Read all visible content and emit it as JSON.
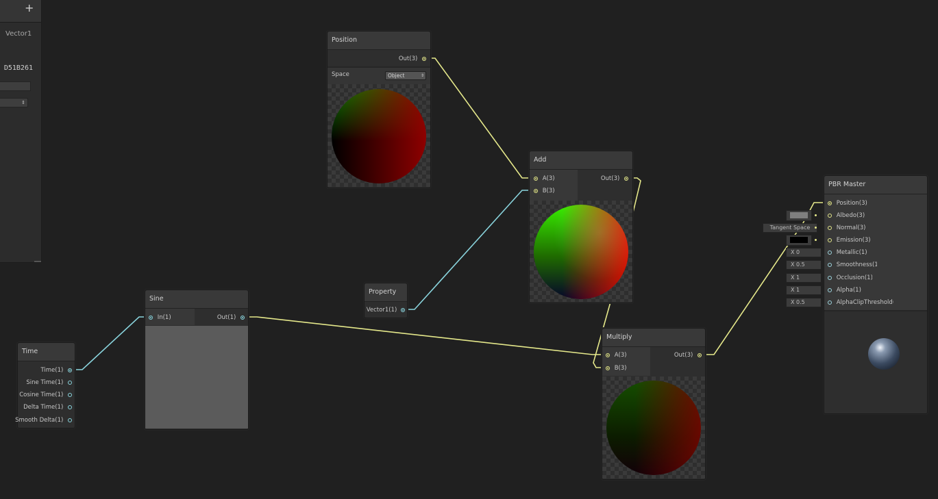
{
  "colors": {
    "background": "#202020",
    "vector3_wire": "#e6e98b",
    "vector1_wire": "#8ad5de",
    "node": "#2e2e2e"
  },
  "blackboard": {
    "add_label": "+",
    "property_type": "Vector1",
    "reference": "D51B261",
    "add_icon": "plus-icon"
  },
  "nodes": {
    "position": {
      "title": "Position",
      "out": "Out(3)",
      "space_label": "Space",
      "space_value": "Object"
    },
    "add": {
      "title": "Add",
      "in_a": "A(3)",
      "in_b": "B(3)",
      "out": "Out(3)"
    },
    "property": {
      "title": "Property",
      "out": "Vector1(1)"
    },
    "sine": {
      "title": "Sine",
      "in": "In(1)",
      "out": "Out(1)"
    },
    "time": {
      "title": "Time",
      "outputs": [
        "Time(1)",
        "Sine Time(1)",
        "Cosine Time(1)",
        "Delta Time(1)",
        "Smooth Delta(1)"
      ]
    },
    "multiply": {
      "title": "Multiply",
      "in_a": "A(3)",
      "in_b": "B(3)",
      "out": "Out(3)"
    },
    "pbr": {
      "title": "PBR Master",
      "inputs": [
        "Position(3)",
        "Albedo(3)",
        "Normal(3)",
        "Emission(3)",
        "Metallic(1)",
        "Smoothness(1)",
        "Occlusion(1)",
        "Alpha(1)",
        "AlphaClipThreshold(1)"
      ],
      "normal_space": "Tangent Space",
      "metallic": "X 0",
      "smoothness": "X 0.5",
      "occlusion": "X 1",
      "alpha": "X 1",
      "alpha_clip": "X 0.5"
    }
  }
}
